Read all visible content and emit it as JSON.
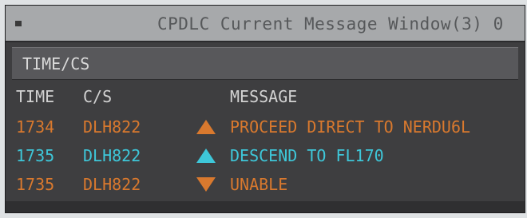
{
  "window": {
    "title": "CPDLC Current Message Window(3) 0"
  },
  "subheader": {
    "label": "TIME/CS"
  },
  "columns": {
    "time": "TIME",
    "cs": "C/S",
    "message": "MESSAGE"
  },
  "colors": {
    "orange": "#d9792e",
    "cyan": "#3ec7d9",
    "window_bg": "#3e3e40",
    "titlebar_bg": "#a7a9ab"
  },
  "messages": [
    {
      "time": "1734",
      "cs": "DLH822",
      "direction": "up",
      "color": "orange",
      "icon": "triangle-up-icon",
      "text": "PROCEED DIRECT TO NERDU6L"
    },
    {
      "time": "1735",
      "cs": "DLH822",
      "direction": "up",
      "color": "cyan",
      "icon": "triangle-up-icon",
      "text": "DESCEND TO FL170"
    },
    {
      "time": "1735",
      "cs": "DLH822",
      "direction": "down",
      "color": "orange",
      "icon": "triangle-down-icon",
      "text": "UNABLE"
    }
  ]
}
